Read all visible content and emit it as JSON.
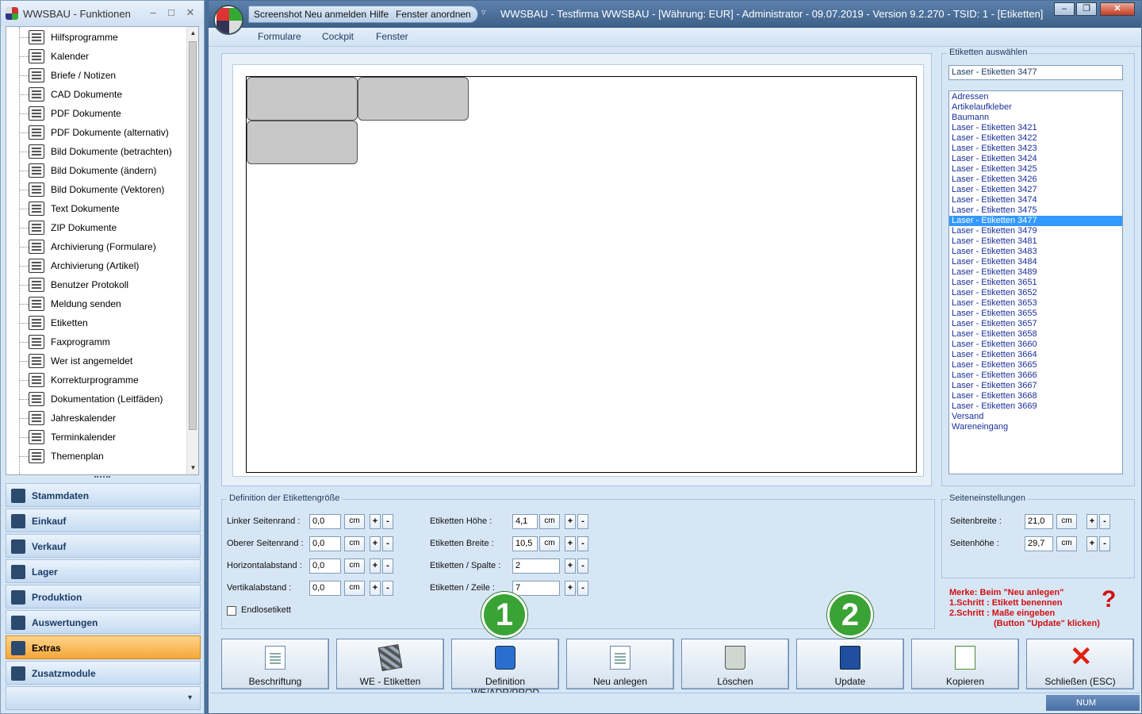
{
  "left_window": {
    "title": "WWSBAU - Funktionen",
    "tree_items": [
      "Hilfsprogramme",
      "Kalender",
      "Briefe / Notizen",
      "CAD Dokumente",
      "PDF Dokumente",
      "PDF Dokumente (alternativ)",
      "Bild Dokumente (betrachten)",
      "Bild Dokumente (ändern)",
      "Bild Dokumente (Vektoren)",
      "Text Dokumente",
      "ZIP Dokumente",
      "Archivierung (Formulare)",
      "Archivierung (Artikel)",
      "Benutzer Protokoll",
      "Meldung senden",
      "Etiketten",
      "Faxprogramm",
      "Wer ist angemeldet",
      "Korrekturprogramme",
      "Dokumentation (Leitfäden)",
      "Jahreskalender",
      "Terminkalender",
      "Themenplan"
    ],
    "nav_buttons": [
      "Stammdaten",
      "Einkauf",
      "Verkauf",
      "Lager",
      "Produktion",
      "Auswertungen",
      "Extras",
      "Zusatzmodule"
    ],
    "active_nav": "Extras"
  },
  "main_window": {
    "quick_access": [
      "Screenshot",
      "Neu anmelden",
      "Hilfe",
      "Fenster anordnen"
    ],
    "caption": "WWSBAU - Testfirma WWSBAU - [Währung: EUR] - Administrator - 09.07.2019 - Version 9.2.270 - TSID: 1 - [Etiketten]",
    "menu": [
      "Formulare",
      "Cockpit",
      "Fenster"
    ]
  },
  "label_select": {
    "title": "Etiketten auswählen",
    "current": "Laser - Etiketten 3477",
    "items": [
      "Adressen",
      "Artikelaufkleber",
      "Baumann",
      "Laser - Etiketten 3421",
      "Laser - Etiketten 3422",
      "Laser - Etiketten 3423",
      "Laser - Etiketten 3424",
      "Laser - Etiketten 3425",
      "Laser - Etiketten 3426",
      "Laser - Etiketten 3427",
      "Laser - Etiketten 3474",
      "Laser - Etiketten 3475",
      "Laser - Etiketten 3477",
      "Laser - Etiketten 3479",
      "Laser - Etiketten 3481",
      "Laser - Etiketten 3483",
      "Laser - Etiketten 3484",
      "Laser - Etiketten 3489",
      "Laser - Etiketten 3651",
      "Laser - Etiketten 3652",
      "Laser - Etiketten 3653",
      "Laser - Etiketten 3655",
      "Laser - Etiketten 3657",
      "Laser - Etiketten 3658",
      "Laser - Etiketten 3660",
      "Laser - Etiketten 3664",
      "Laser - Etiketten 3665",
      "Laser - Etiketten 3666",
      "Laser - Etiketten 3667",
      "Laser - Etiketten 3668",
      "Laser - Etiketten 3669",
      "Versand",
      "Wareneingang"
    ],
    "selected_index": 12
  },
  "definition": {
    "title": "Definition der Etikettengröße",
    "unit": "cm",
    "plus": "+",
    "minus": "-",
    "left_fields": [
      {
        "label": "Linker Seitenrand :",
        "value": "0,0"
      },
      {
        "label": "Oberer Seitenrand :",
        "value": "0,0"
      },
      {
        "label": "Horizontalabstand :",
        "value": "0,0"
      },
      {
        "label": "Vertikalabstand :",
        "value": "0,0"
      }
    ],
    "right_fields": [
      {
        "label": "Etiketten Höhe :",
        "value": "4,1",
        "has_unit": true
      },
      {
        "label": "Etiketten Breite :",
        "value": "10,5",
        "has_unit": true
      },
      {
        "label": "Etiketten / Spalte :",
        "value": "2",
        "has_unit": false
      },
      {
        "label": "Etiketten / Zeile :",
        "value": "7",
        "has_unit": false
      }
    ],
    "endless_label": "Endlosetikett"
  },
  "page_settings": {
    "title": "Seiteneinstellungen",
    "fields": [
      {
        "label": "Seitenbreite :",
        "value": "21,0"
      },
      {
        "label": "Seitenhöhe :",
        "value": "29,7"
      }
    ]
  },
  "hint": {
    "lines": [
      "Merke: Beim \"Neu anlegen\"",
      "1.Schritt : Etikett benennen",
      "2.Schritt : Maße eingeben",
      "(Button \"Update\" klicken)"
    ],
    "qmark": "?"
  },
  "badges": [
    "1",
    "2"
  ],
  "buttons": [
    "Beschriftung",
    "WE - Etiketten",
    "Definition WE/ADR/PROD",
    "Neu anlegen",
    "Löschen",
    "Update",
    "Kopieren",
    "Schließen (ESC)"
  ],
  "status": {
    "num": "NUM"
  },
  "colors": {
    "selection": "#3399ff",
    "hint": "#d01010",
    "badge": "#3aa335",
    "active_nav": "#f5a73a"
  }
}
